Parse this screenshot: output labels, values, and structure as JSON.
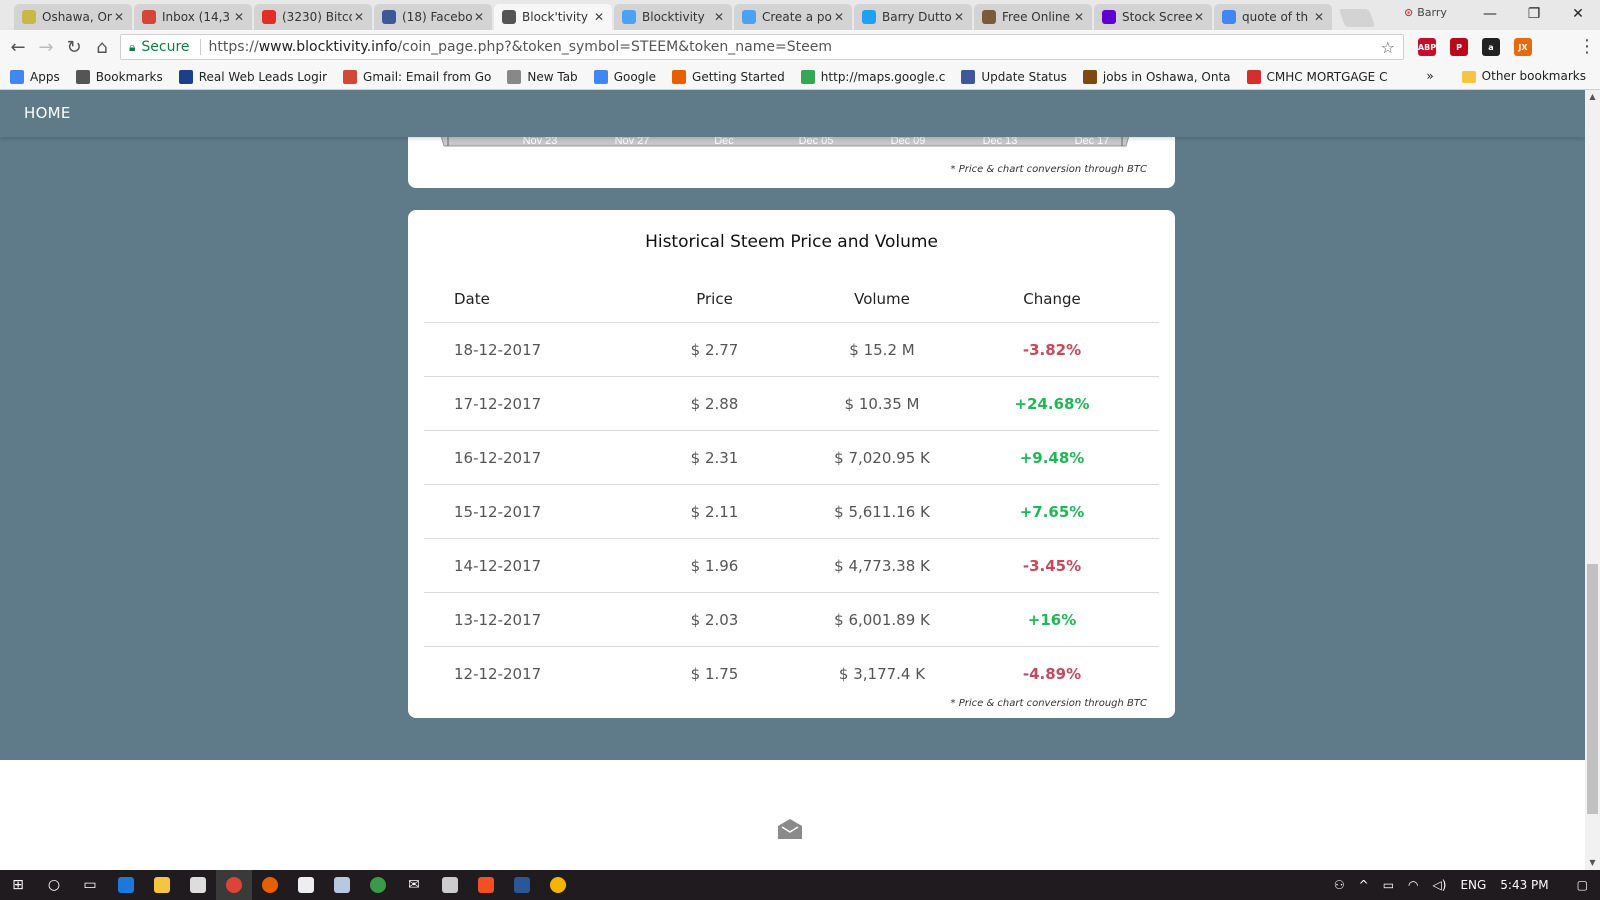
{
  "browser": {
    "tabs": [
      {
        "title": "Oshawa, Ontario",
        "icon": "weather-icon",
        "color": "#c8b84a",
        "active": false
      },
      {
        "title": "Inbox (14,3",
        "icon": "gmail-icon",
        "color": "#d44638",
        "active": false
      },
      {
        "title": "(3230) Bitco",
        "icon": "youtube-icon",
        "color": "#e52d27",
        "active": false
      },
      {
        "title": "(18) Facebo",
        "icon": "facebook-icon",
        "color": "#3b5998",
        "active": false
      },
      {
        "title": "Block'tivity",
        "icon": "blocktivity-icon",
        "color": "#555555",
        "active": true
      },
      {
        "title": "Blocktivity",
        "icon": "steem-icon",
        "color": "#4ba2f2",
        "active": false
      },
      {
        "title": "Create a po",
        "icon": "steem-icon",
        "color": "#4ba2f2",
        "active": false
      },
      {
        "title": "Barry Dutto",
        "icon": "twitter-icon",
        "color": "#1da1f2",
        "active": false
      },
      {
        "title": "Free Online",
        "icon": "grid-icon",
        "color": "#7a5a3a",
        "active": false
      },
      {
        "title": "Stock Scree",
        "icon": "yahoo-icon",
        "color": "#5f01d1",
        "active": false
      },
      {
        "title": "quote of th",
        "icon": "google-icon",
        "color": "#4285f4",
        "active": false
      }
    ],
    "profile_name": "Barry",
    "window_controls": {
      "minimize": "—",
      "restore": "❐",
      "close": "✕"
    },
    "omnibox": {
      "secure_label": "Secure",
      "url_prefix": "https://",
      "url_host": "www.blocktivity.info",
      "url_path": "/coin_page.php?&token_symbol=STEEM&token_name=Steem"
    },
    "extensions": [
      {
        "label": "ABP",
        "badge": "1",
        "color": "#c70d2c"
      },
      {
        "label": "P",
        "badge": "",
        "color": "#bd081c"
      },
      {
        "label": "a",
        "badge": "",
        "color": "#222222"
      },
      {
        "label": "JX",
        "badge": "",
        "color": "#e86a10"
      }
    ],
    "bookmarks": [
      {
        "label": "Apps",
        "icon": "apps-icon",
        "color": "#4285f4"
      },
      {
        "label": "Bookmarks",
        "icon": "star-icon",
        "color": "#555555"
      },
      {
        "label": "Real Web Leads Logir",
        "icon": "leads-icon",
        "color": "#1c3f8a"
      },
      {
        "label": "Gmail: Email from Go",
        "icon": "gmail-icon",
        "color": "#d44638"
      },
      {
        "label": "New Tab",
        "icon": "page-icon",
        "color": "#888888"
      },
      {
        "label": "Google",
        "icon": "google-icon",
        "color": "#4285f4"
      },
      {
        "label": "Getting Started",
        "icon": "firefox-icon",
        "color": "#e66000"
      },
      {
        "label": "http://maps.google.c",
        "icon": "maps-icon",
        "color": "#34a853"
      },
      {
        "label": "Update Status",
        "icon": "facebook-icon",
        "color": "#3b5998"
      },
      {
        "label": "jobs in Oshawa, Onta",
        "icon": "e-icon",
        "color": "#7a4a10"
      },
      {
        "label": "CMHC MORTGAGE C",
        "icon": "cmhc-icon",
        "color": "#d32f2f"
      }
    ],
    "bookmarks_overflow": "»",
    "other_bookmarks": "Other bookmarks"
  },
  "site": {
    "nav_home": "HOME",
    "chart_axis": [
      "Nov 23",
      "Nov 27",
      "Dec",
      "Dec 05",
      "Dec 09",
      "Dec 13",
      "Dec 17"
    ],
    "footnote": "* Price & chart conversion through BTC"
  },
  "history": {
    "title": "Historical Steem Price and Volume",
    "headers": {
      "date": "Date",
      "price": "Price",
      "volume": "Volume",
      "change": "Change"
    },
    "rows": [
      {
        "date": "18-12-2017",
        "price": "$ 2.77",
        "volume": "$ 15.2 M",
        "change": "-3.82%",
        "dir": "neg"
      },
      {
        "date": "17-12-2017",
        "price": "$ 2.88",
        "volume": "$ 10.35 M",
        "change": "+24.68%",
        "dir": "pos"
      },
      {
        "date": "16-12-2017",
        "price": "$ 2.31",
        "volume": "$ 7,020.95 K",
        "change": "+9.48%",
        "dir": "pos"
      },
      {
        "date": "15-12-2017",
        "price": "$ 2.11",
        "volume": "$ 5,611.16 K",
        "change": "+7.65%",
        "dir": "pos"
      },
      {
        "date": "14-12-2017",
        "price": "$ 1.96",
        "volume": "$ 4,773.38 K",
        "change": "-3.45%",
        "dir": "neg"
      },
      {
        "date": "13-12-2017",
        "price": "$ 2.03",
        "volume": "$ 6,001.89 K",
        "change": "+16%",
        "dir": "pos"
      },
      {
        "date": "12-12-2017",
        "price": "$ 1.75",
        "volume": "$ 3,177.4 K",
        "change": "-4.89%",
        "dir": "neg"
      }
    ]
  },
  "taskbar": {
    "language": "ENG",
    "time": "5:43 PM"
  },
  "colors": {
    "page_bg": "#5f7a89",
    "negative": "#c9485b",
    "positive": "#1db954",
    "secure": "#0b8043"
  }
}
